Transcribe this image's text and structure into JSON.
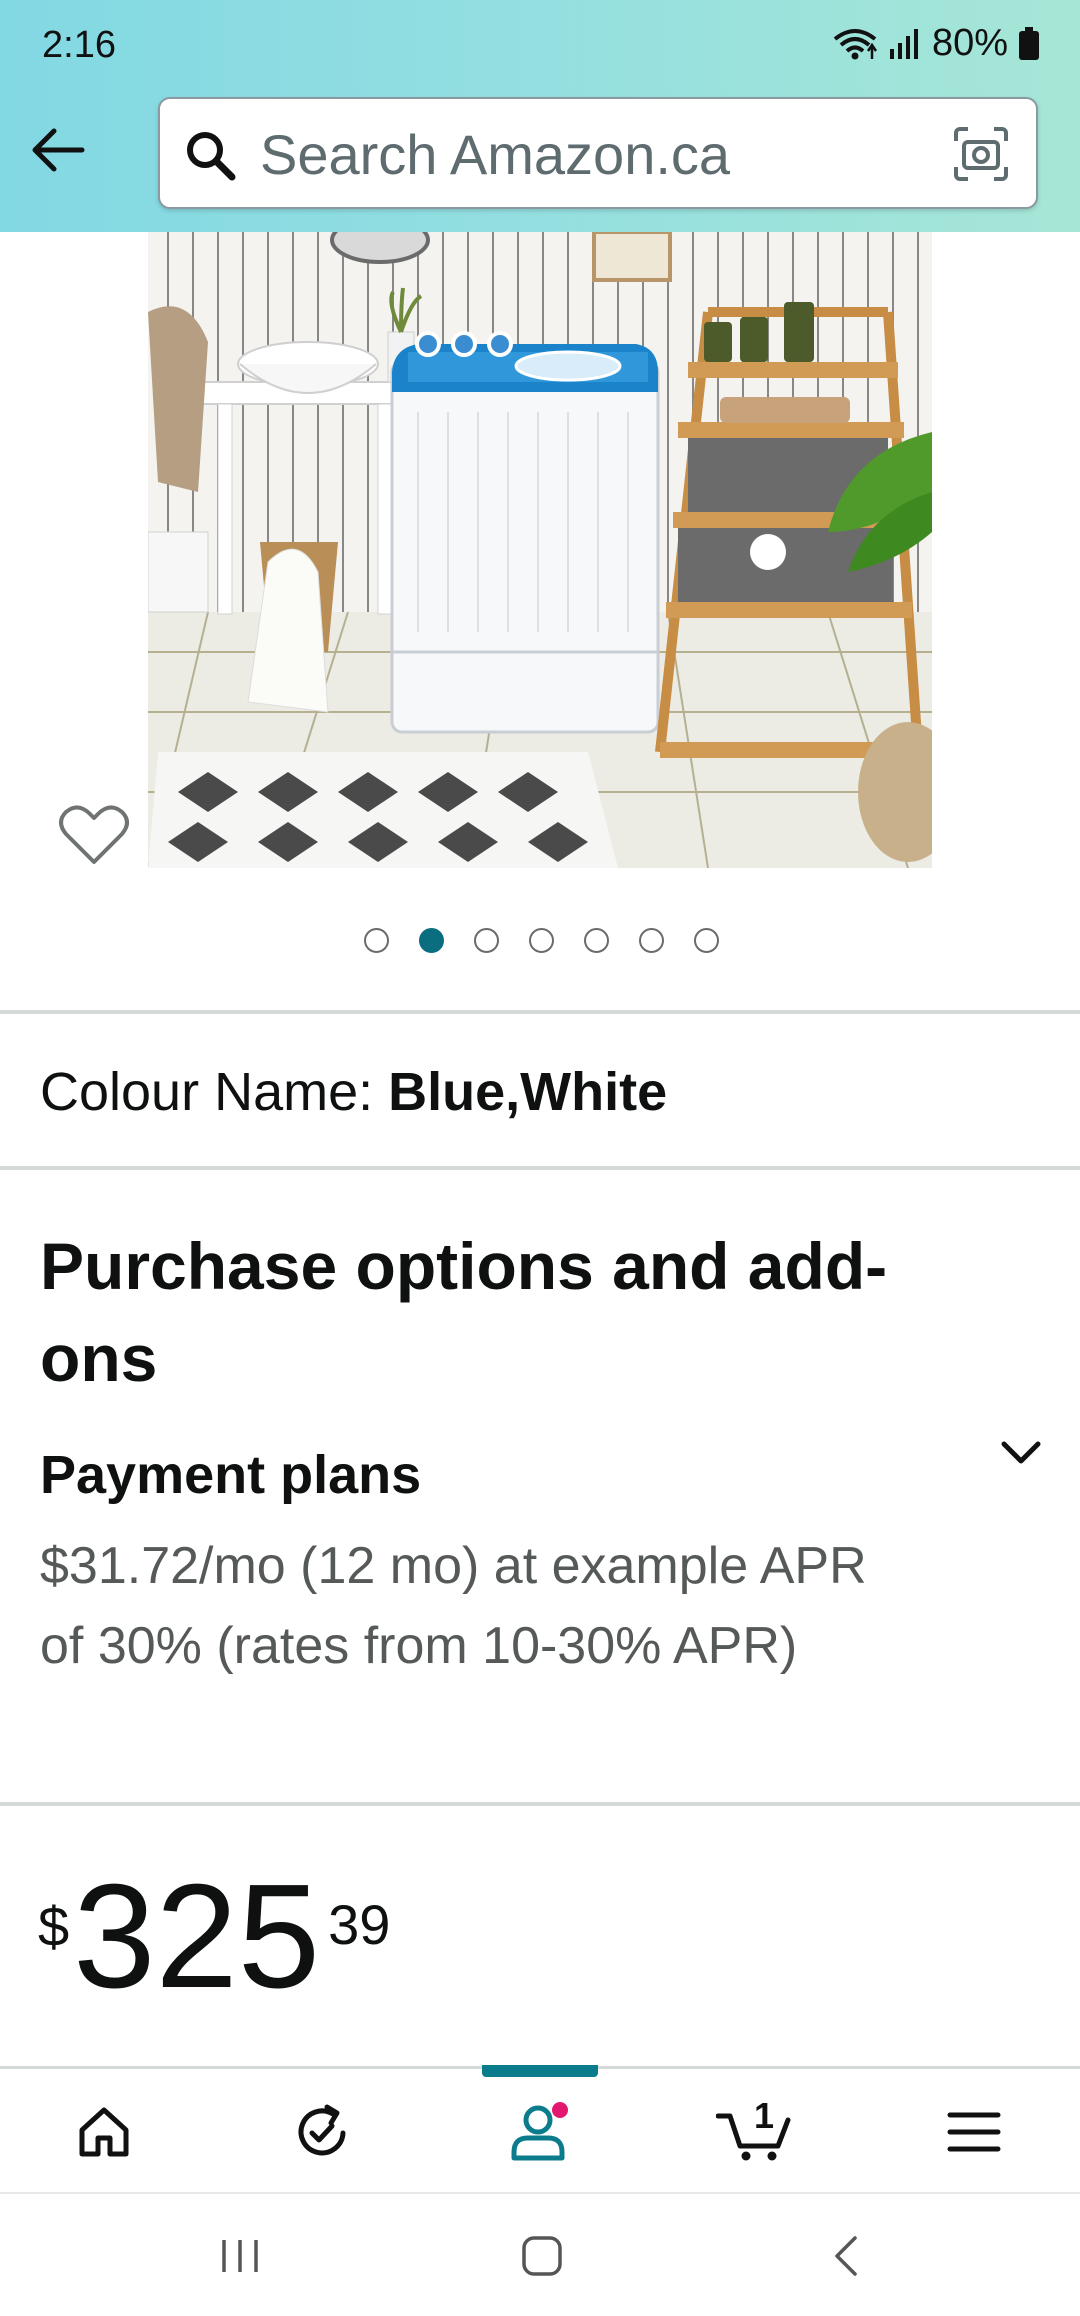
{
  "status": {
    "time": "2:16",
    "battery": "80%"
  },
  "search": {
    "placeholder": "Search Amazon.ca"
  },
  "carousel": {
    "total": 7,
    "active_index": 1
  },
  "product": {
    "colour_label": "Colour Name: ",
    "colour_value": "Blue,White"
  },
  "purchase": {
    "title": "Purchase options and add-ons",
    "payment_plans_label": "Payment plans",
    "payment_plans_desc": "$31.72/mo (12 mo) at example APR of 30% (rates from 10-30% APR)"
  },
  "price": {
    "symbol": "$",
    "whole": "325",
    "fraction": "39"
  },
  "nav": {
    "cart_count": "1",
    "accent": "#0b7c8c",
    "badge_color": "#e3176f"
  },
  "icons": [
    "back-arrow-icon",
    "search-icon",
    "camera-icon",
    "heart-icon",
    "chevron-down-icon",
    "home-icon",
    "buy-again-icon",
    "account-icon",
    "cart-icon",
    "menu-icon"
  ]
}
